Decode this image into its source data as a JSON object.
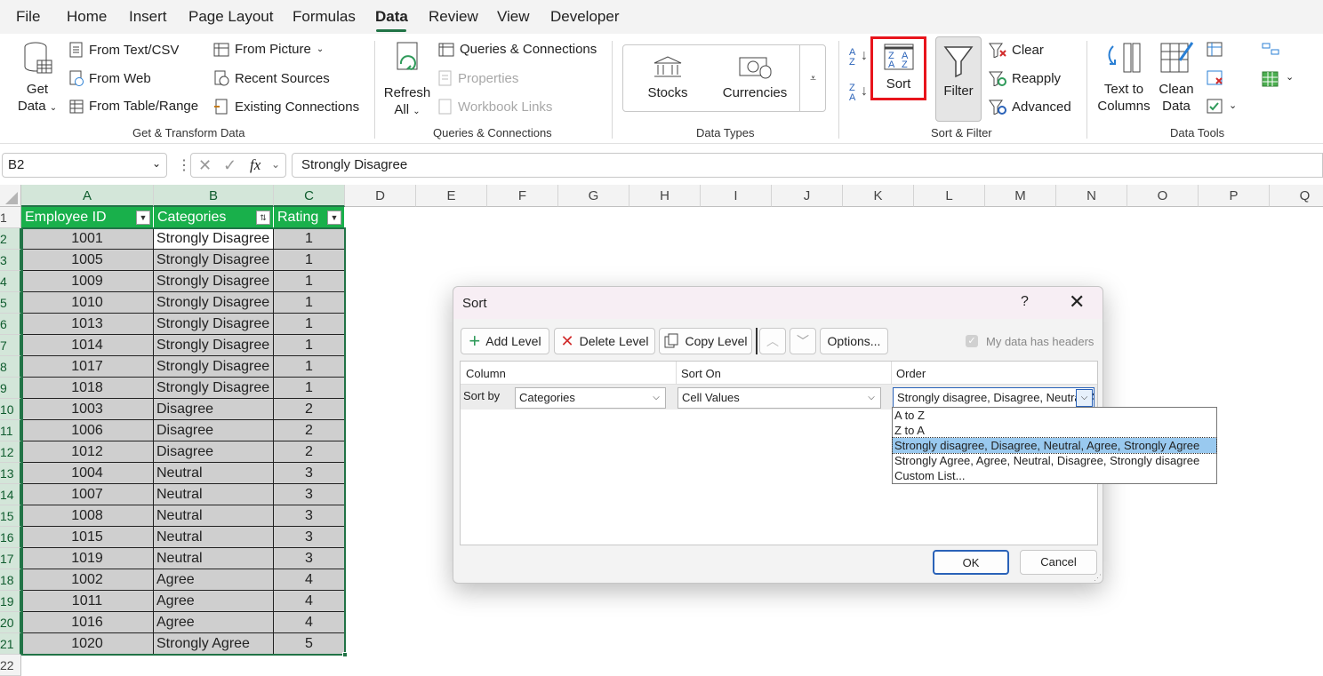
{
  "menu": {
    "tabs": [
      "File",
      "Home",
      "Insert",
      "Page Layout",
      "Formulas",
      "Data",
      "Review",
      "View",
      "Developer"
    ],
    "active": "Data"
  },
  "ribbon": {
    "get_data": {
      "line1": "Get",
      "line2": "Data"
    },
    "from_text_csv": "From Text/CSV",
    "from_web": "From Web",
    "from_table_range": "From Table/Range",
    "from_picture": "From Picture",
    "recent_sources": "Recent Sources",
    "existing_connections": "Existing Connections",
    "group_get_transform": "Get & Transform Data",
    "refresh": {
      "line1": "Refresh",
      "line2": "All"
    },
    "queries_connections": "Queries & Connections",
    "properties": "Properties",
    "workbook_links": "Workbook Links",
    "group_queries": "Queries & Connections",
    "stocks": "Stocks",
    "currencies": "Currencies",
    "group_data_types": "Data Types",
    "sort": "Sort",
    "filter": "Filter",
    "clear": "Clear",
    "reapply": "Reapply",
    "advanced": "Advanced",
    "group_sort_filter": "Sort & Filter",
    "text_to_columns": {
      "line1": "Text to",
      "line2": "Columns"
    },
    "clean_data": {
      "line1": "Clean",
      "line2": "Data"
    },
    "group_data_tools": "Data Tools"
  },
  "formula_bar": {
    "name_box": "B2",
    "fx": "fx",
    "value": "Strongly Disagree"
  },
  "grid": {
    "columns": [
      "A",
      "B",
      "C",
      "D",
      "E",
      "F",
      "G",
      "H",
      "I",
      "J",
      "K",
      "L",
      "M",
      "N",
      "O",
      "P",
      "Q"
    ],
    "row_numbers": [
      "1",
      "2",
      "3",
      "4",
      "5",
      "6",
      "7",
      "8",
      "9",
      "10",
      "11",
      "12",
      "13",
      "14",
      "15",
      "16",
      "17",
      "18",
      "19",
      "20",
      "21",
      "22"
    ],
    "headers": [
      "Employee ID",
      "Categories",
      "Rating"
    ],
    "rows": [
      [
        "1001",
        "Strongly Disagree",
        "1"
      ],
      [
        "1005",
        "Strongly Disagree",
        "1"
      ],
      [
        "1009",
        "Strongly Disagree",
        "1"
      ],
      [
        "1010",
        "Strongly Disagree",
        "1"
      ],
      [
        "1013",
        "Strongly Disagree",
        "1"
      ],
      [
        "1014",
        "Strongly Disagree",
        "1"
      ],
      [
        "1017",
        "Strongly Disagree",
        "1"
      ],
      [
        "1018",
        "Strongly Disagree",
        "1"
      ],
      [
        "1003",
        "Disagree",
        "2"
      ],
      [
        "1006",
        "Disagree",
        "2"
      ],
      [
        "1012",
        "Disagree",
        "2"
      ],
      [
        "1004",
        "Neutral",
        "3"
      ],
      [
        "1007",
        "Neutral",
        "3"
      ],
      [
        "1008",
        "Neutral",
        "3"
      ],
      [
        "1015",
        "Neutral",
        "3"
      ],
      [
        "1019",
        "Neutral",
        "3"
      ],
      [
        "1002",
        "Agree",
        "4"
      ],
      [
        "1011",
        "Agree",
        "4"
      ],
      [
        "1016",
        "Agree",
        "4"
      ],
      [
        "1020",
        "Strongly Agree",
        "5"
      ]
    ]
  },
  "dialog": {
    "title": "Sort",
    "help": "?",
    "add_level": "Add Level",
    "delete_level": "Delete Level",
    "copy_level": "Copy Level",
    "options": "Options...",
    "my_data_headers": "My data has headers",
    "col_header": "Column",
    "sort_on_header": "Sort On",
    "order_header": "Order",
    "sort_by": "Sort by",
    "column_value": "Categories",
    "sort_on_value": "Cell Values",
    "order_value": "Strongly disagree, Disagree, Neutral, Agree, Strongly Agree",
    "order_options": [
      "A to Z",
      "Z to A",
      "Strongly disagree, Disagree, Neutral, Agree, Strongly Agree",
      "Strongly Agree, Agree, Neutral, Disagree, Strongly disagree",
      "Custom List..."
    ],
    "ok": "OK",
    "cancel": "Cancel"
  },
  "colors": {
    "accent": "#217346",
    "header_fill": "#19b04b",
    "highlight_red": "#e8141c",
    "selection": "#99c9ef"
  }
}
